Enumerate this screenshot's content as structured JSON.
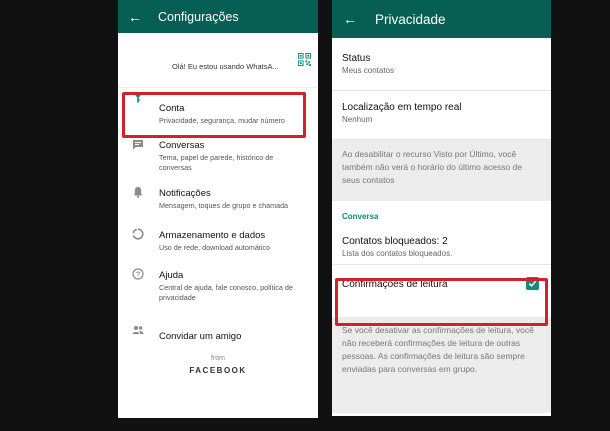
{
  "left": {
    "title": "Configurações",
    "profile_status": "Olá! Eu estou usando WhatsA...",
    "items": [
      {
        "label": "Conta",
        "sub": "Privacidade, segurança, mudar número"
      },
      {
        "label": "Conversas",
        "sub": "Tema, papel de parede, histórico de conversas"
      },
      {
        "label": "Notificações",
        "sub": "Mensagem, toques de grupo e chamada"
      },
      {
        "label": "Armazenamento e dados",
        "sub": "Uso de rede, download automático"
      },
      {
        "label": "Ajuda",
        "sub": "Central de ajuda, fale conosco, política de privacidade"
      },
      {
        "label": "Convidar um amigo"
      }
    ],
    "footer_from": "from",
    "footer_brand": "FACEBOOK",
    "icons": {
      "back": "arrow-left-icon",
      "qr": "qr-code-icon",
      "conta": "key-icon",
      "conversas": "chat-icon",
      "notificacoes": "bell-icon",
      "armazenamento": "data-usage-icon",
      "ajuda": "help-icon",
      "convidar": "people-icon"
    }
  },
  "right": {
    "title": "Privacidade",
    "status": {
      "label": "Status",
      "sub": "Meus contatos"
    },
    "localizacao": {
      "label": "Localização em tempo real",
      "sub": "Nenhum"
    },
    "note_visto": "Ao desabilitar o recurso Visto por Último, você também não verá o horário do último acesso de seus contatos",
    "section": "Conversa",
    "bloqueados": {
      "label": "Contatos bloqueados: 2",
      "sub": "Lista dos contatos bloqueados."
    },
    "confirmacoes": {
      "label": "Confirmações de leitura",
      "checked": true
    },
    "note_confirmacoes": "Se você desativar as confirmações de leitura, você não receberá confirmações de leitura de outras pessoas. As confirmações de leitura são sempre enviadas para conversas em grupo."
  },
  "colors": {
    "appbar": "#075e54",
    "accent": "#128c7e",
    "section_header": "#0c8a7b",
    "highlight": "#d0222b",
    "icon_grey": "#8a8a8a"
  }
}
